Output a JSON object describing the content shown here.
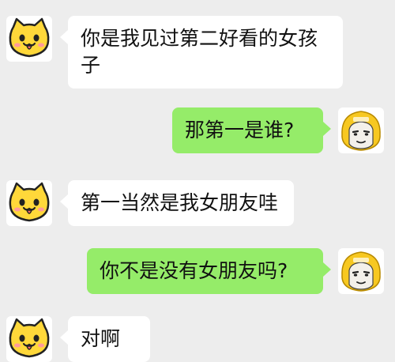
{
  "messages": [
    {
      "side": "left",
      "text": "你是我见过第二好看的女孩子",
      "avatar": "cat-emoji-icon"
    },
    {
      "side": "right",
      "text": "那第一是谁?",
      "avatar": "helmet-meme-icon"
    },
    {
      "side": "left",
      "text": "第一当然是我女朋友哇",
      "avatar": "cat-emoji-icon"
    },
    {
      "side": "right",
      "text": "你不是没有女朋友吗?",
      "avatar": "helmet-meme-icon"
    },
    {
      "side": "left",
      "text": "对啊",
      "avatar": "cat-emoji-icon"
    }
  ],
  "colors": {
    "background": "#ededed",
    "left_bubble": "#ffffff",
    "right_bubble": "#95ec69",
    "cat_yellow": "#ffd83a",
    "helmet_yellow": "#f7c821"
  }
}
